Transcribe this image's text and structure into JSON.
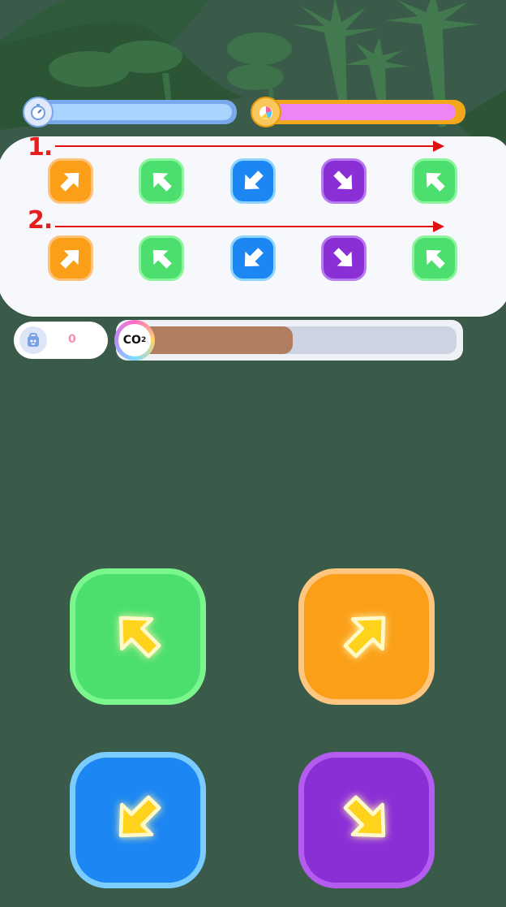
{
  "timer_bar": {
    "icon": "stopwatch-icon",
    "track_color": "#8ab8f5",
    "fill_color": "#a8d4ff",
    "level": 1.0
  },
  "power_bar": {
    "icon": "pepper-icon",
    "track_color": "#f2a81a",
    "fill_color": "#ec86f6",
    "level": 1.0
  },
  "sequence": {
    "rows": [
      {
        "label": "1.",
        "tiles": [
          "up-right",
          "up-left",
          "down-left",
          "down-right",
          "up-left"
        ]
      },
      {
        "label": "2.",
        "tiles": [
          "up-right",
          "up-left",
          "down-left",
          "down-right",
          "up-left"
        ]
      }
    ]
  },
  "score": {
    "icon": "backpack-icon",
    "value": "0"
  },
  "co2": {
    "label": "CO",
    "subscript": "2",
    "level": 0.49,
    "fill_color": "#b07d60"
  },
  "controls": [
    {
      "direction": "up-left",
      "color": "#4cdf6f",
      "border": "#7bf58e",
      "name": "up-left-button"
    },
    {
      "direction": "up-right",
      "color": "#fb9f18",
      "border": "#ffc680",
      "name": "up-right-button"
    },
    {
      "direction": "down-left",
      "color": "#1c86f2",
      "border": "#7ccdff",
      "name": "down-left-button"
    },
    {
      "direction": "down-right",
      "color": "#8a2fd6",
      "border": "#b45cf0",
      "name": "down-right-button"
    }
  ],
  "colors": {
    "up-right": [
      "#fb9f18",
      "#ffc27a"
    ],
    "up-left": [
      "#4cdf6f",
      "#8bf59c"
    ],
    "down-left": [
      "#1c86f2",
      "#8fd4ff"
    ],
    "down-right": [
      "#8a2fd6",
      "#b77bf0"
    ]
  }
}
